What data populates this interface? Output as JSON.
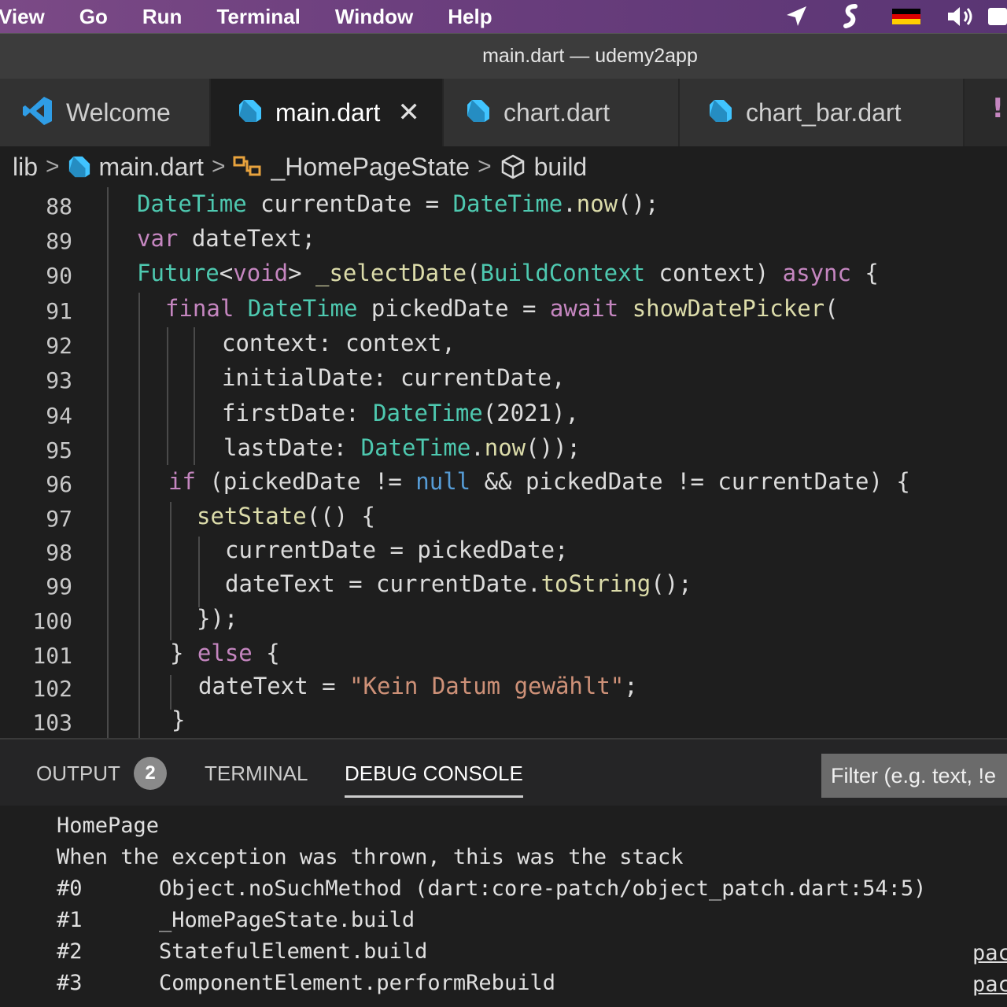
{
  "menubar": {
    "items": [
      "View",
      "Go",
      "Run",
      "Terminal",
      "Window",
      "Help"
    ],
    "tray_icons": [
      "location-arrow-icon",
      "script-icon",
      "german-flag-icon",
      "volume-icon"
    ]
  },
  "window": {
    "title": "main.dart — udemy2app"
  },
  "tabs": [
    {
      "label": "Welcome",
      "icon": "vscode-icon",
      "active": false
    },
    {
      "label": "main.dart",
      "icon": "dart-file-icon",
      "active": true
    },
    {
      "label": "chart.dart",
      "icon": "dart-file-icon",
      "active": false
    },
    {
      "label": "chart_bar.dart",
      "icon": "dart-file-icon",
      "active": false
    }
  ],
  "breadcrumb": [
    "lib",
    "main.dart",
    "_HomePageState",
    "build"
  ],
  "editor": {
    "line_numbers": [
      "88",
      "89",
      "90",
      "91",
      "92",
      "93",
      "94",
      "95",
      "96",
      "97",
      "98",
      "99",
      "100",
      "101",
      "102",
      "103"
    ]
  },
  "panel": {
    "tabs": [
      "OUTPUT",
      "TERMINAL",
      "DEBUG CONSOLE"
    ],
    "output_badge": "2",
    "filter_placeholder": "Filter (e.g. text, !e",
    "console_lines": [
      "HomePage",
      "When the exception was thrown, this was the stack",
      "#0      Object.noSuchMethod (dart:core-patch/object_patch.dart:54:5)",
      "#1      _HomePageState.build",
      "#2      StatefulElement.build",
      "#3      ComponentElement.performRebuild"
    ],
    "side_links": [
      "pac",
      "pac"
    ]
  },
  "colors": {
    "menubar": "#6c3f7e",
    "keyword": "#c586c0",
    "type": "#4ec9b0",
    "function": "#dcdcaa",
    "string": "#ce9178",
    "literal": "#569cd6"
  }
}
